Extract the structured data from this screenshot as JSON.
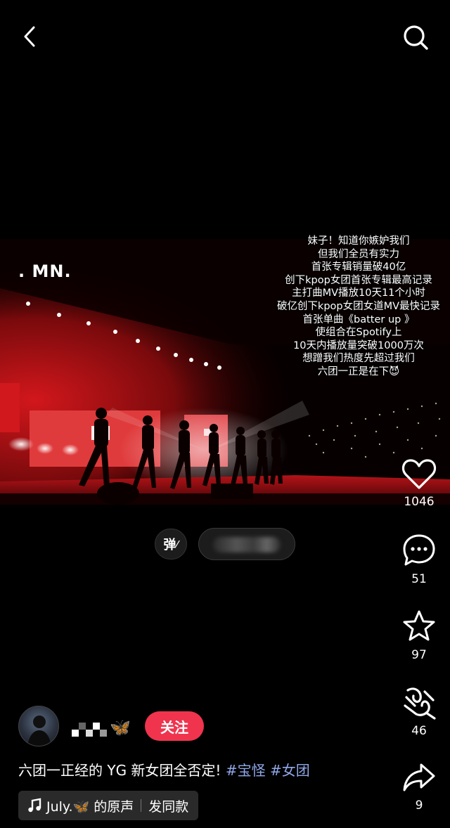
{
  "nav": {
    "back_icon": "back-chevron-icon",
    "search_icon": "search-icon"
  },
  "video": {
    "watermark": ". MN.",
    "overlay_lines": [
      "妹子！知道你嫉妒我们",
      "但我们全员有实力",
      "首张专辑销量破40亿",
      "创下kpop女团首张专辑最高记录",
      "主打曲MV播放10天11个小时",
      "破亿创下kpop女团女道MV最快记录",
      "首张单曲《batter up 》",
      "使组合在Spotify上",
      "10天内播放量突破1000万次",
      "想蹭我们热度先超过我们",
      "六团一正是在下😈"
    ]
  },
  "danmaku": {
    "toggle_label": "弹"
  },
  "actions": {
    "like_count": "1046",
    "comment_count": "51",
    "favorite_count": "97",
    "share_wechat_count": "46",
    "share_count": "9"
  },
  "author": {
    "name_emoji": "🦋",
    "follow_label": "关注"
  },
  "caption": {
    "text": "六团一正经的 YG 新女团全否定!",
    "tags": [
      "#宝怪",
      "#女团"
    ]
  },
  "music": {
    "label": "July.🦋 的原声",
    "action": "发同款"
  },
  "colors": {
    "follow": "#f0344e",
    "tag": "#8fa8e8",
    "stage_red": "#c8151b"
  }
}
